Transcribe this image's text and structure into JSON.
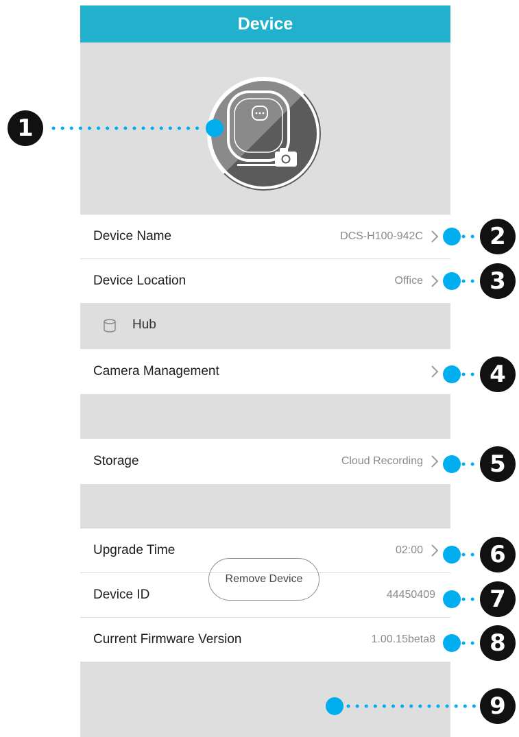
{
  "header": {
    "title": "Device"
  },
  "settings": {
    "device_name": {
      "label": "Device Name",
      "value": "DCS-H100-942C"
    },
    "device_location": {
      "label": "Device Location",
      "value": "Office"
    },
    "hub_section": {
      "label": "Hub"
    },
    "camera_management": {
      "label": "Camera Management"
    },
    "storage": {
      "label": "Storage",
      "value": "Cloud Recording"
    },
    "upgrade_time": {
      "label": "Upgrade Time",
      "value": "02:00"
    },
    "device_id": {
      "label": "Device ID",
      "value": "44450409"
    },
    "firmware": {
      "label": "Current Firmware Version",
      "value": "1.00.15beta8"
    }
  },
  "remove_button": {
    "label": "Remove Device"
  },
  "callouts": [
    "1",
    "2",
    "3",
    "4",
    "5",
    "6",
    "7",
    "8",
    "9"
  ],
  "colors": {
    "header": "#21b1cc",
    "callout_dot": "#00aeef",
    "callout_badge": "#111111",
    "section_background": "#dedede"
  },
  "icons": {
    "device_photo": "camera-device-icon",
    "hub": "hub-cylinder-icon",
    "chevron": "chevron-right-icon"
  }
}
